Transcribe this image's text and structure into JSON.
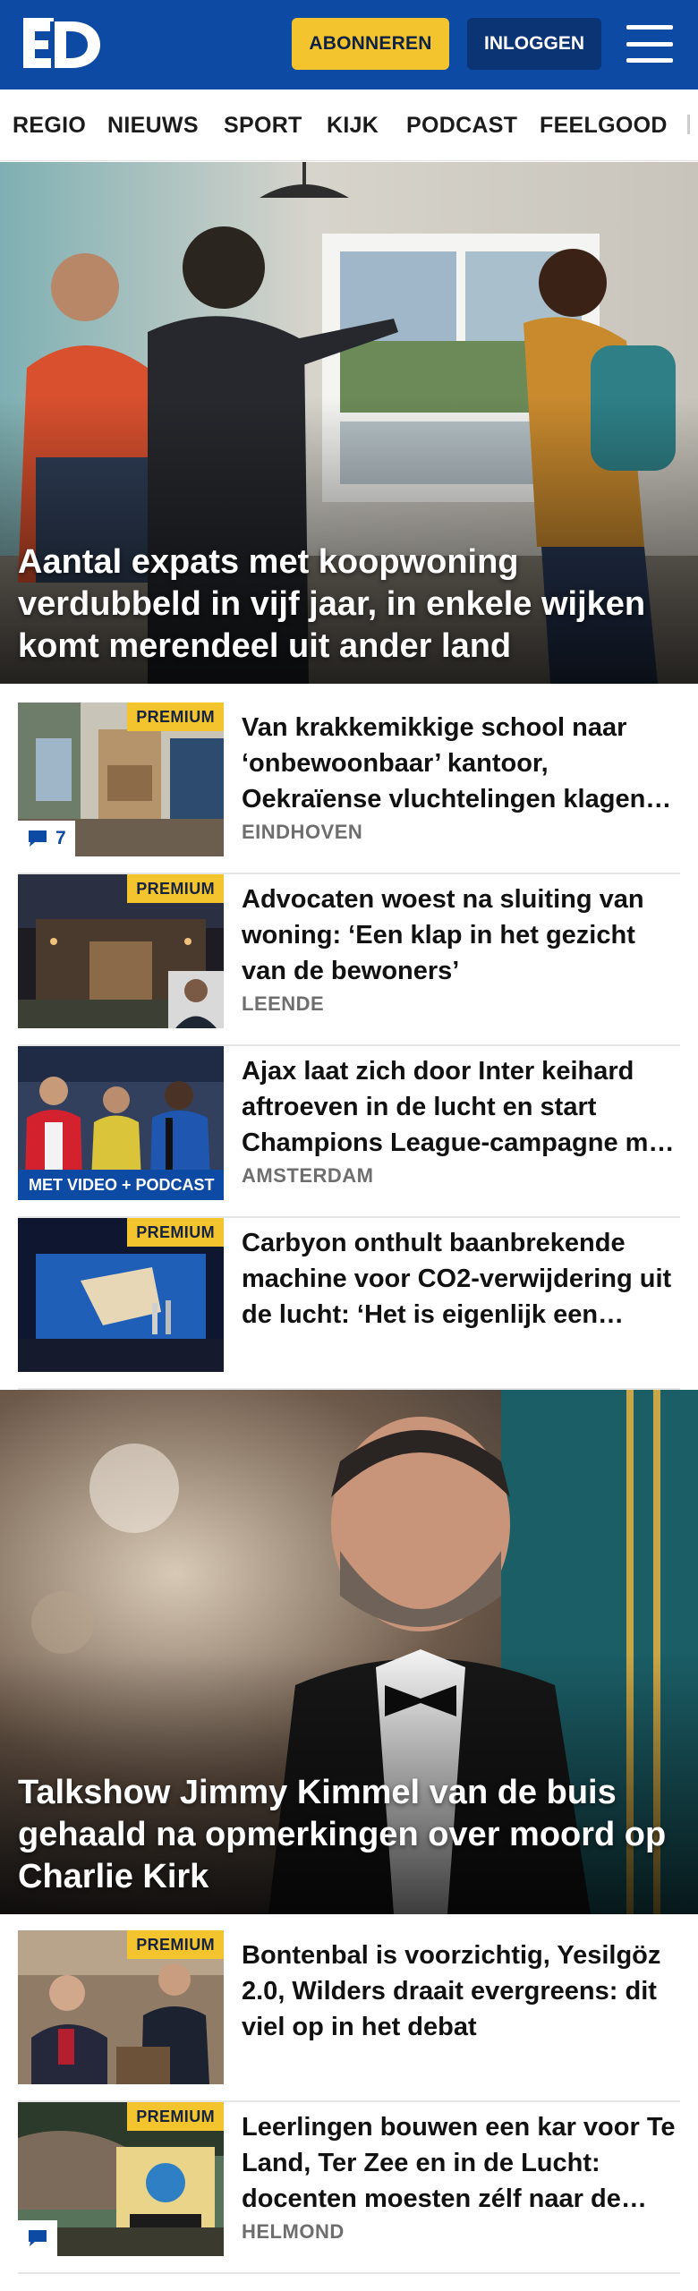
{
  "header": {
    "logo_text": "ED",
    "subscribe_label": "ABONNEREN",
    "login_label": "INLOGGEN",
    "menu_icon": "hamburger-menu-icon"
  },
  "nav": {
    "items": [
      "REGIO",
      "NIEUWS",
      "SPORT",
      "KIJK",
      "PODCAST",
      "FEELGOOD"
    ]
  },
  "hero1": {
    "title": "Aantal expats met koopwoning verdubbeld in vijf jaar, in enkele wijken komt merendeel uit ander land"
  },
  "articles1": [
    {
      "title": "Van krakkemikkige school naar ‘onbewoonbaar’ kantoor, Oekraïense vluchtelingen klagen over hun opvang",
      "place": "EINDHOVEN",
      "badge": "PREMIUM",
      "comments": "7"
    },
    {
      "title": "Advocaten woest na sluiting van woning: ‘Een klap in het gezicht van de bewoners’",
      "place": "LEENDE",
      "badge": "PREMIUM"
    },
    {
      "title": "Ajax laat zich door Inter keihard aftroeven in de lucht en start Champions League-campagne met een nederlaag",
      "place": "AMSTERDAM",
      "video_badge": "MET VIDEO + PODCAST"
    },
    {
      "title": "Carbyon onthult baanbrekende machine voor CO2-verwijdering uit de lucht: ‘Het is eigenlijk een revolutie’",
      "badge": "PREMIUM"
    }
  ],
  "hero2": {
    "title": "Talkshow Jimmy Kimmel van de buis gehaald na opmerkingen over moord op Charlie Kirk"
  },
  "articles2": [
    {
      "title": "Bontenbal is voorzichtig, Yesilgöz 2.0, Wilders draait evergreens: dit viel op in het debat",
      "badge": "PREMIUM"
    },
    {
      "title": "Leerlingen bouwen een kar voor Te Land, Ter Zee en in de Lucht: docenten moesten zélf naar de winkel",
      "place": "HELMOND",
      "badge": "PREMIUM"
    }
  ],
  "colors": {
    "brand_blue": "#0d4aa3",
    "subscribe_yellow": "#f3c42d",
    "login_navy": "#0a3474",
    "premium_yellow": "#f3c42d"
  }
}
